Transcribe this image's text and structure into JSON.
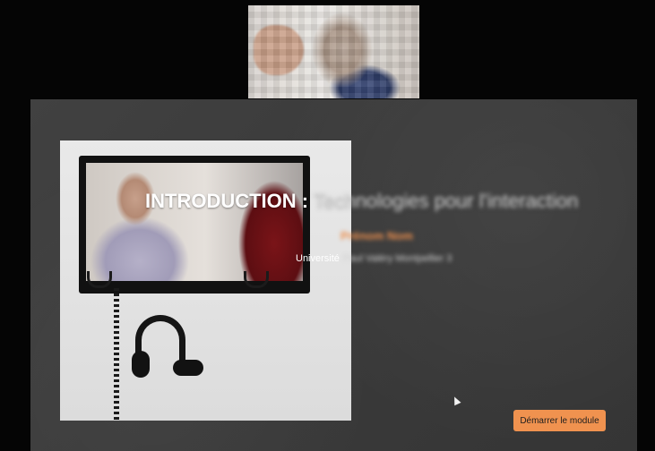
{
  "slide": {
    "title_prefix": "INTRODUCTION :",
    "title_rest": "Technologies pour l'interaction",
    "author": "Prénom Nom",
    "university_prefix": "Université",
    "university_rest": "Paul Valéry Montpellier 3",
    "start_button_label": "Démarrer le module"
  },
  "icons": {
    "cursor": "mouse-pointer-icon"
  },
  "colors": {
    "slide_background": "#3b3b3b",
    "accent_orange": "#f0924f",
    "title_white": "#ffffff"
  }
}
